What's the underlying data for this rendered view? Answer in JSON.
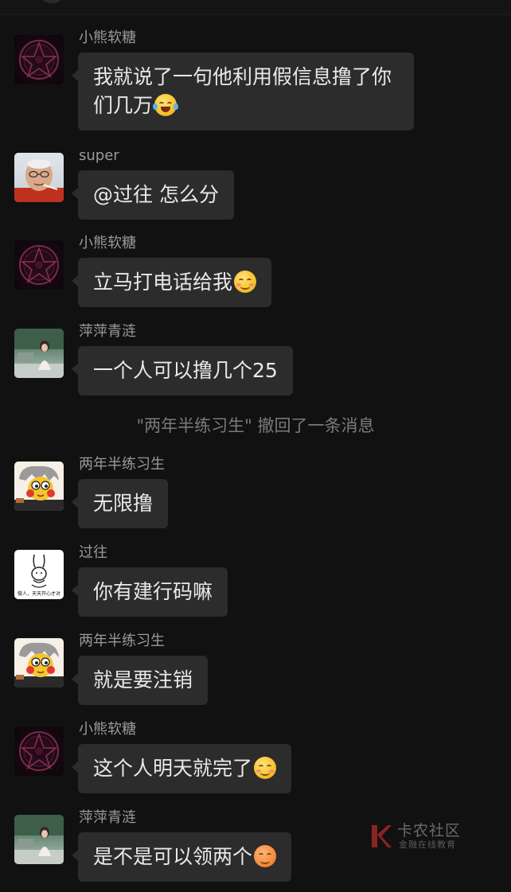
{
  "messages": [
    {
      "sender": "小熊软糖",
      "avatar": "bear-avatar",
      "text": "我就说了一句他利用假信息撸了你们几万",
      "emoji": "laughing-tears-emoji"
    },
    {
      "sender": "super",
      "avatar": "old-man-avatar",
      "text": "@过往 怎么分",
      "emoji": ""
    },
    {
      "sender": "小熊软糖",
      "avatar": "bear-avatar",
      "text": "立马打电话给我",
      "emoji": "smirk-blush-emoji"
    },
    {
      "sender": "萍萍青涟",
      "avatar": "girl-photo-avatar",
      "text": "一个人可以撸几个25",
      "emoji": ""
    },
    {
      "sender": "两年半练习生",
      "avatar": "cartoon-avatar",
      "text": "无限撸",
      "emoji": ""
    },
    {
      "sender": "过往",
      "avatar": "rabbit-avatar",
      "text": "你有建行码嘛",
      "emoji": ""
    },
    {
      "sender": "两年半练习生",
      "avatar": "cartoon-avatar",
      "text": "就是要注销",
      "emoji": ""
    },
    {
      "sender": "小熊软糖",
      "avatar": "bear-avatar",
      "text": "这个人明天就完了",
      "emoji": "smirk-blush-emoji"
    },
    {
      "sender": "萍萍青涟",
      "avatar": "girl-photo-avatar",
      "text": "是不是可以领两个",
      "emoji": "hot-face-emoji"
    }
  ],
  "recall_notice": "\"两年半练习生\" 撤回了一条消息",
  "rabbit_avatar_caption": "做人，天天开心才对",
  "watermark": {
    "title": "卡农社区",
    "subtitle": "金融在线教育"
  },
  "colors": {
    "background": "#111111",
    "bubble": "#2c2c2c",
    "bubble_text": "#e9e9e9",
    "sender_name": "#9a9a9a",
    "system_text": "#7a7a7a"
  }
}
